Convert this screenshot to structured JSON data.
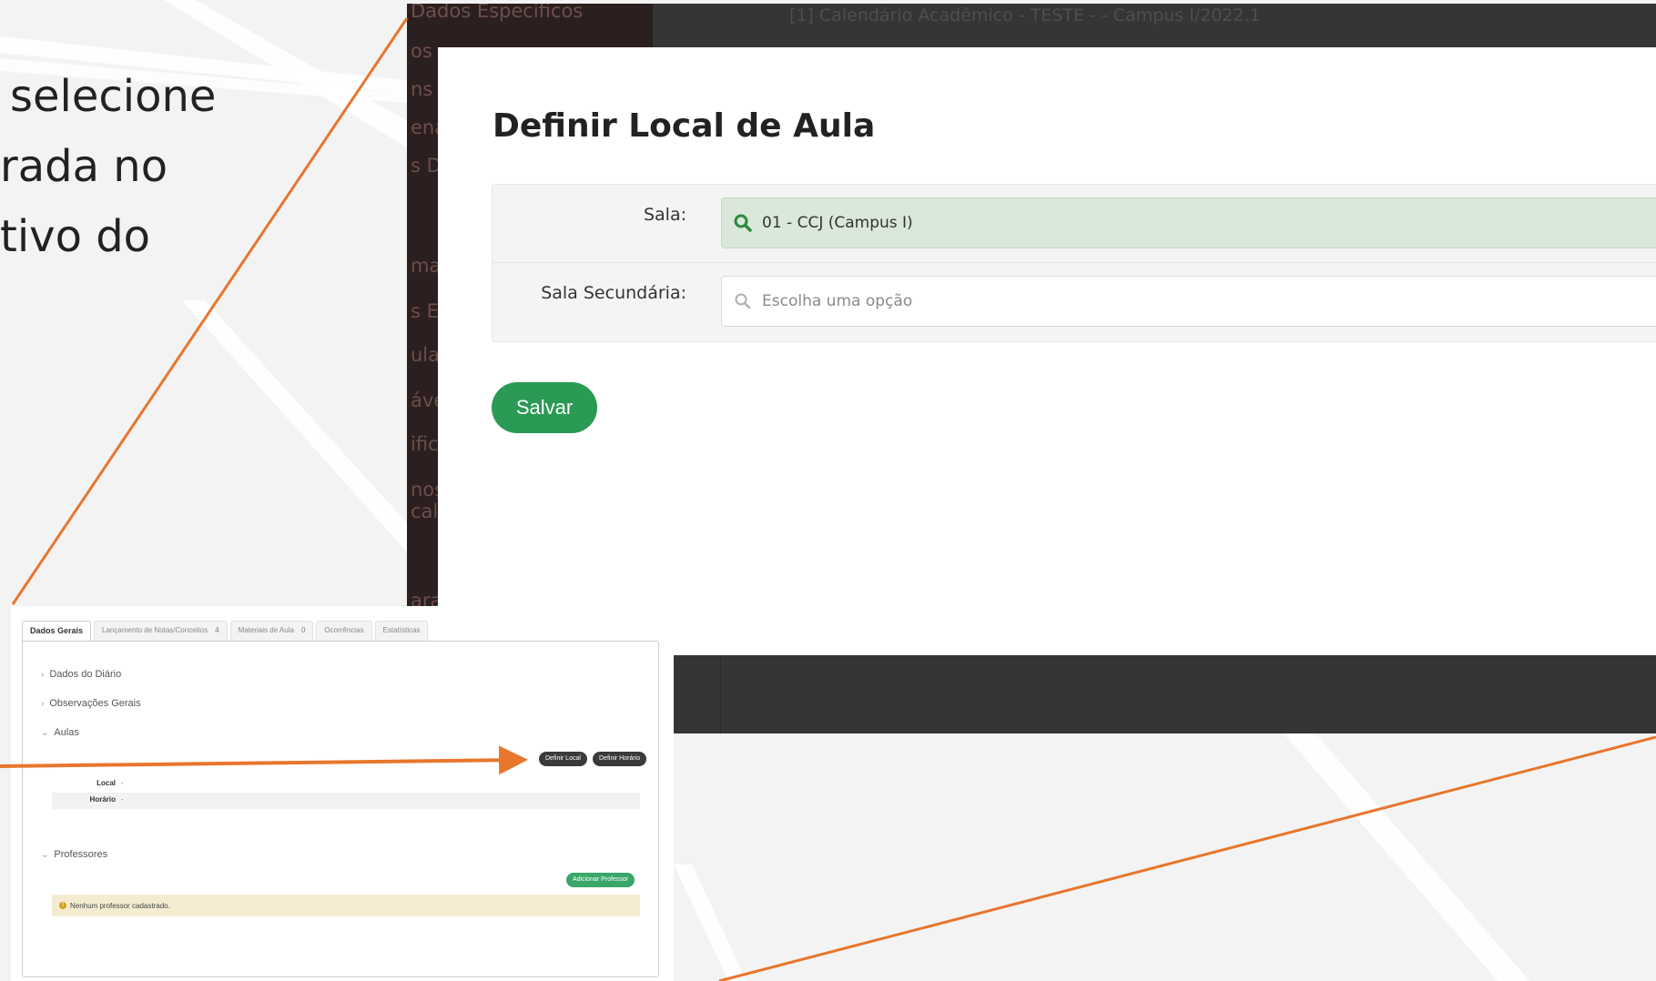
{
  "slide": {
    "lines": [
      "selecione",
      "rada no",
      "tivo do"
    ]
  },
  "colors": {
    "accent_orange": "#e8762c",
    "save_green": "#2a9a55",
    "selected_field": "#d9e8d9",
    "dark_bar": "#353535"
  },
  "app": {
    "calendar_title": "[1] Calendário Acadêmico - TESTE - - Campus I/2022.1",
    "sidebar_items": [
      "Dados Específicos",
      "os",
      "ns",
      "ena",
      "s D",
      "",
      "mas",
      "s Ele",
      "ulaç",
      "áve",
      "ific",
      "nos",
      "calh",
      "ara"
    ]
  },
  "modal": {
    "title": "Definir Local de Aula",
    "fields": [
      {
        "label": "Sala:",
        "value": "01 - CCJ (Campus I)",
        "placeholder": ""
      },
      {
        "label": "Sala Secundária:",
        "value": "",
        "placeholder": "Escolha uma opção"
      }
    ],
    "save_label": "Salvar"
  },
  "inset": {
    "tabs": [
      {
        "label": "Dados Gerais",
        "count": ""
      },
      {
        "label": "Lançamento de Notas/Conceitos",
        "count": "4"
      },
      {
        "label": "Materiais de Aula",
        "count": "0"
      },
      {
        "label": "Ocorrências",
        "count": ""
      },
      {
        "label": "Estatísticas",
        "count": ""
      }
    ],
    "sections": [
      "Dados do Diário",
      "Observações Gerais",
      "Aulas",
      "Professores"
    ],
    "define_local_label": "Definir Local",
    "define_horario_label": "Definir Horário",
    "local_label": "Local",
    "local_value": "-",
    "horario_label": "Horário",
    "horario_value": "-",
    "add_professor_label": "Adicionar Professor",
    "no_professor_text": "Nenhum professor cadastrado."
  }
}
